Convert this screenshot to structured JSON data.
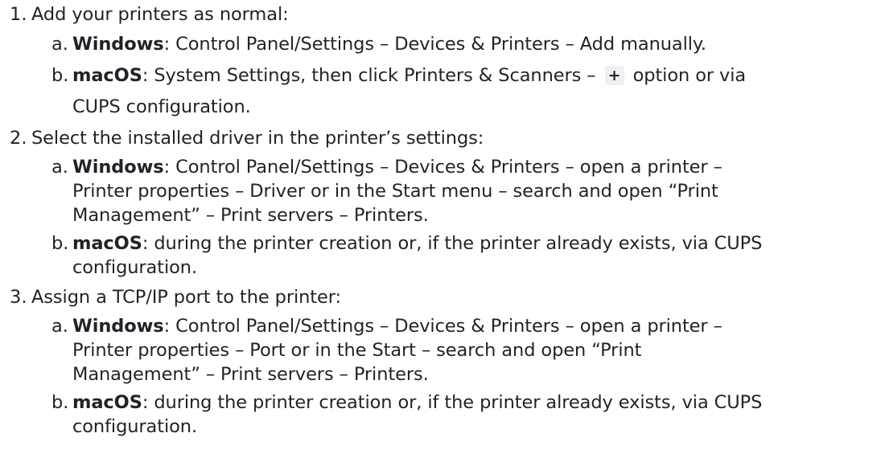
{
  "items": [
    {
      "marker": "1.",
      "lines": [
        "Add your printers as normal:"
      ],
      "subitems": [
        {
          "marker": "a.",
          "os": "Windows",
          "lines": [
            ": Control Panel/Settings – Devices & Printers – Add manually."
          ]
        },
        {
          "marker": "b.",
          "os": "macOS",
          "line1_before_icon": ": System Settings, then click Printers & Scanners –",
          "icon": "plus-icon",
          "icon_glyph": "+",
          "line1_after_icon": "option or via",
          "lines": [
            "CUPS configuration."
          ]
        }
      ]
    },
    {
      "marker": "2.",
      "lines": [
        "Select the installed driver in the printer’s settings:"
      ],
      "subitems": [
        {
          "marker": "a.",
          "os": "Windows",
          "lines": [
            ": Control Panel/Settings – Devices & Printers – open a printer –",
            "Printer properties – Driver or in the Start menu – search and open “Print",
            "Management” – Print servers – Printers."
          ]
        },
        {
          "marker": "b.",
          "os": "macOS",
          "lines": [
            ": during the printer creation or, if the printer already exists, via CUPS",
            "configuration."
          ]
        }
      ]
    },
    {
      "marker": "3.",
      "lines": [
        "Assign a TCP/IP port to the printer:"
      ],
      "subitems": [
        {
          "marker": "a.",
          "os": "Windows",
          "lines": [
            ": Control Panel/Settings – Devices & Printers – open a printer –",
            "Printer properties – Port or in the Start – search and open “Print",
            "Management” – Print servers – Printers."
          ]
        },
        {
          "marker": "b.",
          "os": "macOS",
          "lines": [
            ": during the printer creation or, if the printer already exists, via CUPS",
            "configuration."
          ]
        }
      ]
    }
  ]
}
